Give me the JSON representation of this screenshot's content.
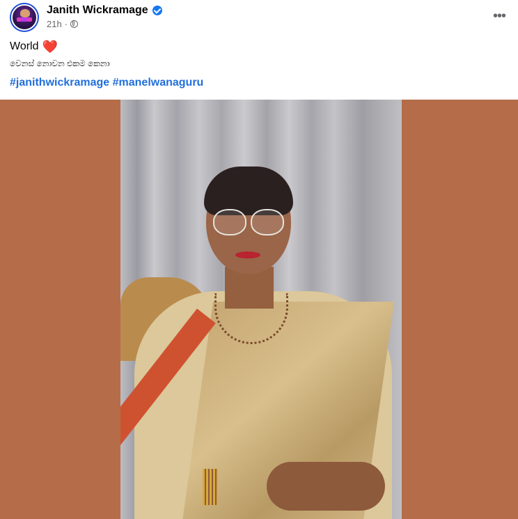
{
  "post": {
    "author": "Janith Wickramage",
    "verified_icon": "verified-badge-icon",
    "time": "21h",
    "separator": "·",
    "audience_icon": "globe-icon",
    "more_icon": "more-options-icon",
    "more_label": "•••",
    "text_line1": "World",
    "heart": "❤️",
    "text_line2": "වෙනස් නොවන එකම කෙනා",
    "hashtags": [
      "#janithwickramage",
      "#manelwanaguru"
    ],
    "media_background": "#b56c48",
    "link_color": "#216fdb"
  }
}
